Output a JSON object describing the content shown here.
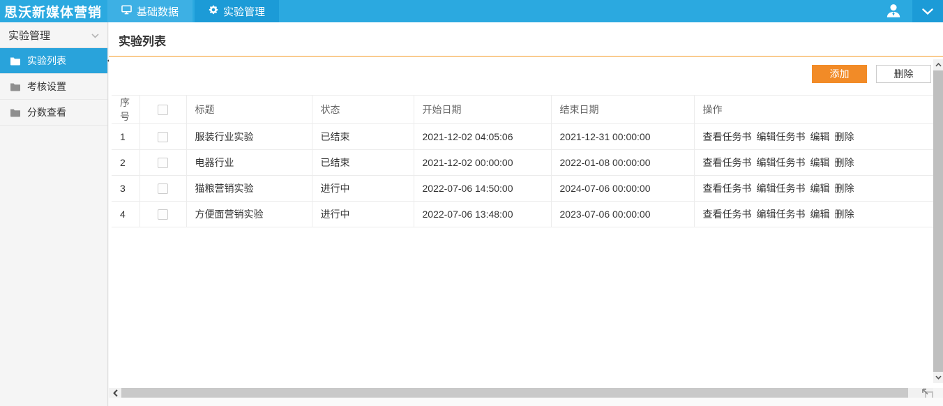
{
  "topbar": {
    "logo": "思沃新媒体营销",
    "tabs": [
      {
        "label": "基础数据",
        "icon": "monitor-icon",
        "active": false
      },
      {
        "label": "实验管理",
        "icon": "gear-icon",
        "active": true
      }
    ],
    "right_icons": [
      "user-icon",
      "chevron-down-icon"
    ]
  },
  "sidebar": {
    "header": {
      "label": "实验管理",
      "icon": "chevron-down-icon"
    },
    "items": [
      {
        "label": "实验列表",
        "icon": "folder-icon",
        "active": true
      },
      {
        "label": "考核设置",
        "icon": "folder-icon",
        "active": false
      },
      {
        "label": "分数查看",
        "icon": "folder-icon",
        "active": false
      }
    ]
  },
  "main": {
    "title": "实验列表",
    "toolbar": {
      "add_label": "添加",
      "delete_label": "删除"
    },
    "table": {
      "headers": [
        "序号",
        "标题",
        "状态",
        "开始日期",
        "结束日期",
        "操作"
      ],
      "action_labels": [
        "查看任务书",
        "编辑任务书",
        "编辑",
        "删除"
      ],
      "rows": [
        {
          "index": "1",
          "title": "服装行业实验",
          "status": "已结束",
          "start": "2021-12-02 04:05:06",
          "end": "2021-12-31 00:00:00",
          "checked": false
        },
        {
          "index": "2",
          "title": "电器行业",
          "status": "已结束",
          "start": "2021-12-02 00:00:00",
          "end": "2022-01-08 00:00:00",
          "checked": false
        },
        {
          "index": "3",
          "title": "猫粮营销实验",
          "status": "进行中",
          "start": "2022-07-06 14:50:00",
          "end": "2024-07-06 00:00:00",
          "checked": false
        },
        {
          "index": "4",
          "title": "方便面营销实验",
          "status": "进行中",
          "start": "2022-07-06 13:48:00",
          "end": "2023-07-06 00:00:00",
          "checked": false
        }
      ]
    }
  },
  "colors": {
    "topbar_blue": "#2BA9E0",
    "active_tab_blue": "#1C9BD7",
    "inactive_tab_blue": "#3DB0E4",
    "selected_item_blue": "#29A3DB",
    "accent_orange": "#F59A23",
    "add_button_orange": "#F28B27"
  }
}
